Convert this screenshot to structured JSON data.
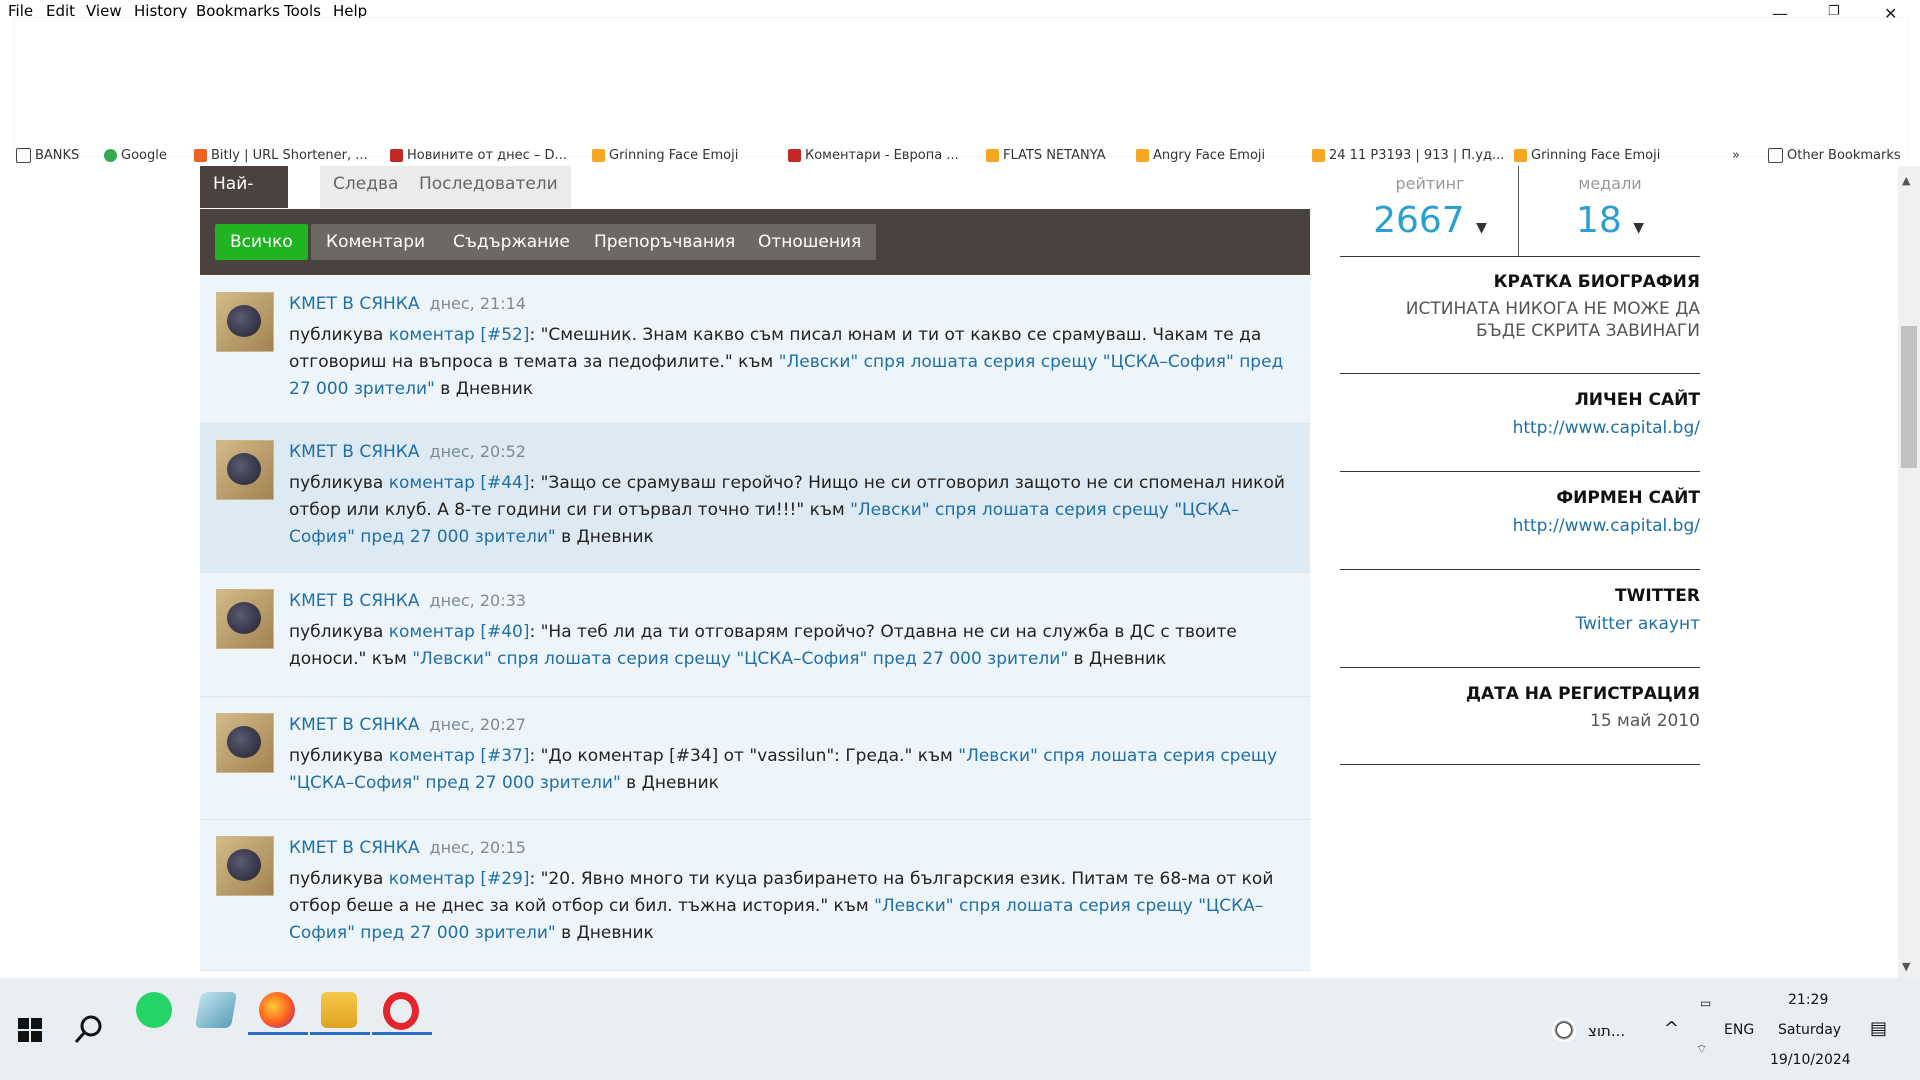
{
  "menu": {
    "items": [
      "File",
      "Edit",
      "View",
      "History",
      "Bookmarks",
      "Tools",
      "Help"
    ],
    "window_buttons": [
      "—",
      "❐",
      "✕"
    ]
  },
  "bookmarks": [
    {
      "label": "BANKS",
      "color": "#ffffff"
    },
    {
      "label": "Google",
      "color": "#34a853"
    },
    {
      "label": "Bitly | URL Shortener, ...",
      "color": "#ee6123"
    },
    {
      "label": "Новините от днес – D...",
      "color": "#c62828"
    },
    {
      "label": "Grinning Face Emoji",
      "color": "#f5a623"
    },
    {
      "label": "Коментари - Европа ...",
      "color": "#c62828"
    },
    {
      "label": "FLATS NETANYA",
      "color": "#f5a623"
    },
    {
      "label": "Angry Face Emoji",
      "color": "#f5a623"
    },
    {
      "label": "24 11 P3193 | 913 | П.уд...",
      "color": "#f5a623"
    },
    {
      "label": "Grinning Face Emoji",
      "color": "#f5a623"
    },
    {
      "label": "Other Bookmarks",
      "color": "#ffffff"
    }
  ],
  "tabs": [
    {
      "label": "Най-новото",
      "active": true
    },
    {
      "label": "Следва",
      "active": false
    },
    {
      "label": "Последователи",
      "active": false
    }
  ],
  "filters": [
    {
      "label": "Всичко",
      "active": true
    },
    {
      "label": "Коментари",
      "active": false
    },
    {
      "label": "Съдържание",
      "active": false
    },
    {
      "label": "Препоръчвания",
      "active": false
    },
    {
      "label": "Отношения",
      "active": false
    }
  ],
  "feed": [
    {
      "author": "КМЕТ В СЯНКА",
      "time": "днес, 21:14",
      "verb": "публикува ",
      "comment_link": "коментар [#52]",
      "quote": ": \"Смешник. Знам какво съм писал юнам и ти от какво се срамуваш. Чакам те да отговориш на въпроса в темата за педофилите.\" към ",
      "article": "\"Левски\" спря лошата серия срещу \"ЦСКА–София\" пред 27 000 зрители\"",
      "suffix": " в Дневник"
    },
    {
      "author": "КМЕТ В СЯНКА",
      "time": "днес, 20:52",
      "verb": "публикува ",
      "comment_link": "коментар [#44]",
      "quote": ": \"Защо се срамуваш геройчо? Нищо не си отговорил защото не си споменал никой отбор или клуб. А 8-те години си ги отървал точно ти!!!\" към ",
      "article": "\"Левски\" спря лошата серия срещу \"ЦСКА–София\" пред 27 000 зрители\"",
      "suffix": " в Дневник"
    },
    {
      "author": "КМЕТ В СЯНКА",
      "time": "днес, 20:33",
      "verb": "публикува ",
      "comment_link": "коментар [#40]",
      "quote": ": \"На теб ли да ти отговарям геройчо? Отдавна не си на служба в ДС с твоите доноси.\" към ",
      "article": "\"Левски\" спря лошата серия срещу \"ЦСКА–София\" пред 27 000 зрители\"",
      "suffix": " в Дневник"
    },
    {
      "author": "КМЕТ В СЯНКА",
      "time": "днес, 20:27",
      "verb": "публикува ",
      "comment_link": "коментар [#37]",
      "quote": ": \"До коментар [#34] от \"vassilun\": Греда.\" към ",
      "article": "\"Левски\" спря лошата серия срещу \"ЦСКА–София\" пред 27 000 зрители\"",
      "suffix": " в Дневник"
    },
    {
      "author": "КМЕТ В СЯНКА",
      "time": "днес, 20:15",
      "verb": "публикува ",
      "comment_link": "коментар [#29]",
      "quote": ": \"20. Явно много ти куца разбирането на българския език. Питам те 68-ма от кой отбор беше а не днес за кой отбор си бил. тъжна история.\" към ",
      "article": "\"Левски\" спря лошата серия срещу \"ЦСКА–София\" пред 27 000 зрители\"",
      "suffix": " в Дневник"
    }
  ],
  "profile": {
    "rating_label": "рейтинг",
    "rating_value": "2667",
    "medals_label": "медали",
    "medals_value": "18",
    "bio_title": "КРАТКА БИОГРАФИЯ",
    "bio_text": "ИСТИНАТА НИКОГА НЕ МОЖЕ ДА БЪДЕ СКРИТА ЗАВИНАГИ",
    "personal_site_title": "ЛИЧЕН САЙТ",
    "personal_site": "http://www.capital.bg/",
    "company_site_title": "ФИРМЕН САЙТ",
    "company_site": "http://www.capital.bg/",
    "twitter_title": "TWITTER",
    "twitter_link": "Twitter акаунт",
    "registration_title": "ДАТА НА РЕГИСТРАЦИЯ",
    "registration_date": "15 май 2010"
  },
  "taskbar": {
    "weather_text": "תוצ...",
    "language": "ENG",
    "time": "21:29",
    "day": "Saturday",
    "date": "19/10/2024"
  },
  "colors": {
    "accent": "#1f6fa8",
    "rating": "#2a9fd6",
    "active_filter": "#22b322",
    "bar": "#4a423f"
  }
}
